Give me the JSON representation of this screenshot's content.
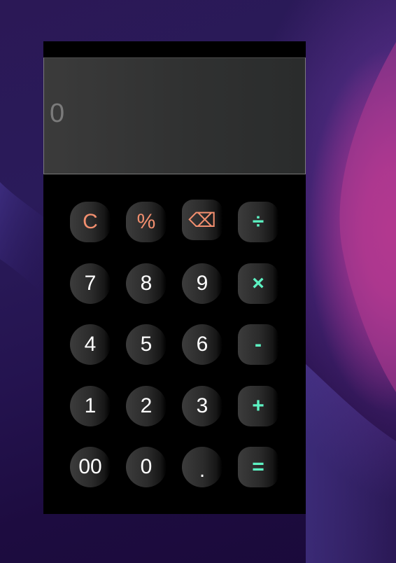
{
  "display": {
    "value": "0"
  },
  "keys": {
    "clear": "C",
    "percent": "%",
    "backspace": "⌫",
    "divide": "÷",
    "seven": "7",
    "eight": "8",
    "nine": "9",
    "multiply": "×",
    "four": "4",
    "five": "5",
    "six": "6",
    "subtract": "-",
    "one": "1",
    "two": "2",
    "three": "3",
    "add": "+",
    "double_zero": "00",
    "zero": "0",
    "decimal": ".",
    "equals": "="
  },
  "colors": {
    "digit": "#ffffff",
    "function": "#f28f6f",
    "operator": "#5df2c2",
    "display_text": "#7b7b7b"
  }
}
